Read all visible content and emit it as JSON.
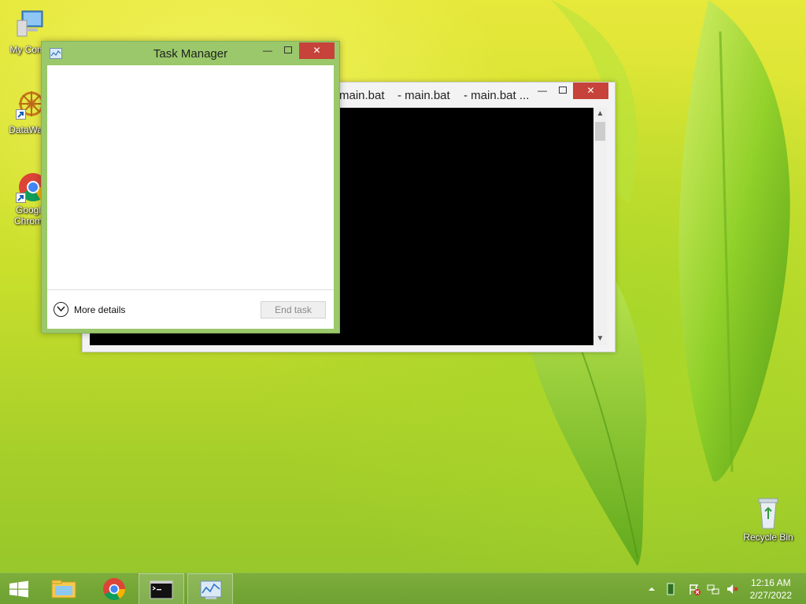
{
  "desktop": {
    "icons": [
      {
        "label": "My Comp"
      },
      {
        "label": "DataWag"
      },
      {
        "label": "Googl Chrom"
      },
      {
        "label": "Recycle Bin"
      }
    ]
  },
  "console_window": {
    "tab_titles": [
      "main.bat",
      "- main.bat",
      "- main.bat ..."
    ]
  },
  "task_manager": {
    "title": "Task Manager",
    "more_details_label": "More details",
    "end_task_label": "End task"
  },
  "taskbar": {
    "items": [
      "start-button",
      "file-explorer-icon",
      "chrome-icon",
      "command-prompt-icon",
      "task-manager-icon"
    ]
  },
  "clock": {
    "time": "12:16 AM",
    "date": "2/27/2022"
  },
  "colors": {
    "close_button": "#c7423a",
    "task_manager_frame": "#9ac86a",
    "taskbar": "#74a636"
  }
}
